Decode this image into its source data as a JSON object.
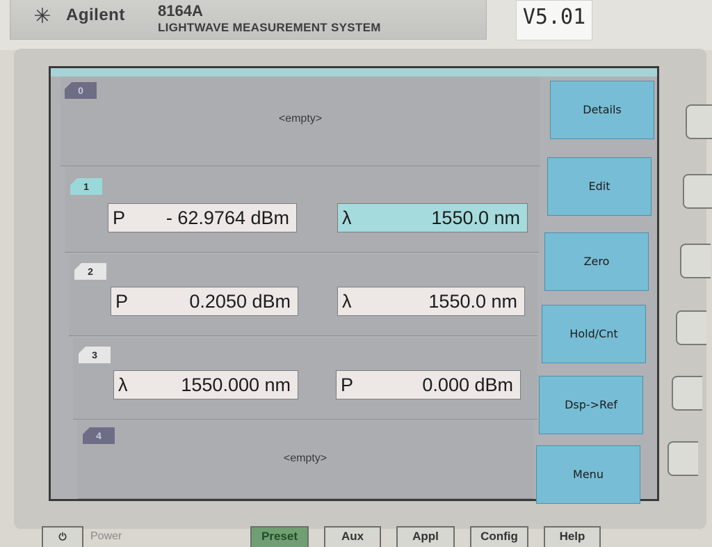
{
  "header": {
    "brand": "Agilent",
    "model": "8164A",
    "system_name": "LIGHTWAVE MEASUREMENT SYSTEM",
    "version": "V5.01"
  },
  "channels": [
    {
      "number": "0",
      "empty_text": "<empty>"
    },
    {
      "number": "1",
      "left": {
        "symbol": "P",
        "value": "- 62.9764 dBm"
      },
      "right": {
        "symbol": "λ",
        "value": "1550.0 nm"
      }
    },
    {
      "number": "2",
      "left": {
        "symbol": "P",
        "value": "0.2050 dBm"
      },
      "right": {
        "symbol": "λ",
        "value": "1550.0 nm"
      }
    },
    {
      "number": "3",
      "left": {
        "symbol": "λ",
        "value": "1550.000 nm"
      },
      "right": {
        "symbol": "P",
        "value": "0.000 dBm"
      }
    },
    {
      "number": "4",
      "empty_text": "<empty>"
    }
  ],
  "softkeys": [
    "Details",
    "Edit",
    "Zero",
    "Hold/Cnt",
    "Dsp->Ref",
    "Menu"
  ],
  "front_panel": {
    "power_label": "Power",
    "buttons": [
      "Preset",
      "Aux",
      "Appl",
      "Config",
      "Help"
    ]
  },
  "colors": {
    "screen_bg": "#b0b1b4",
    "softkey_bg": "#77bdd6",
    "highlight_field": "#a5dbdd",
    "preset_button": "#6f9f73"
  }
}
